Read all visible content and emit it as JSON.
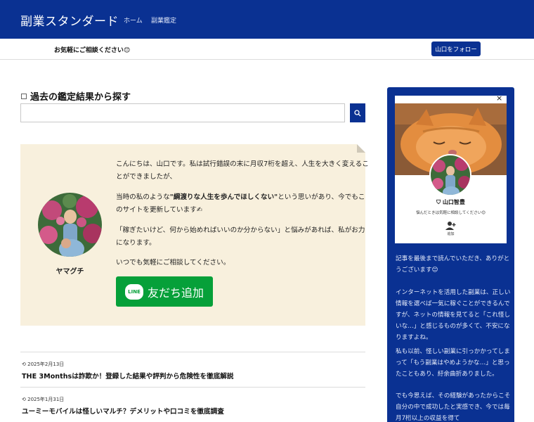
{
  "header": {
    "site_title": "副業スタンダード",
    "nav": [
      "ホーム",
      "副業鑑定"
    ]
  },
  "notice": {
    "text": "お気軽にご相談ください😊",
    "follow_button": "山口をフォロー"
  },
  "search": {
    "heading": "過去の鑑定結果から探す",
    "value": "",
    "placeholder": ""
  },
  "profile": {
    "name": "ヤマグチ",
    "para1": "こんにちは、山口です。私は試行錯誤の末に月収7桁を超え、人生を大きく変えることができましたが、",
    "para2_pre": "当時の私のような",
    "para2_bold": "\"綱渡りな人生を歩んでほしくない\"",
    "para2_post": "という思いがあり、今でもこのサイトを更新しています✍",
    "para3": "「稼ぎたいけど、何から始めればいいのか分からない」と悩みがあれば、私がお力になります。",
    "para4": "いつでも気軽にご相談してください。",
    "line_logo": "LINE",
    "line_button": "友だち追加"
  },
  "posts": [
    {
      "date": "2025年2月13日",
      "title": "THE 3Monthsは詐欺か！登録した結果や評判から危険性を徹底解説"
    },
    {
      "date": "2025年1月31日",
      "title": "ユーミーモバイルは怪しいマルチ？デメリットや口コミを徹底調査"
    }
  ],
  "sidebar": {
    "close": "×",
    "widget_name": "山口智豊",
    "widget_message": "悩んだときは気軽に相談してください😊",
    "widget_follow_label": "追加",
    "text1": "記事を最後まで読んでいただき、ありがとうございます😊",
    "text2": "インターネットを活用した副業は、正しい情報を選べば一気に稼ぐことができるんですが、ネットの情報を見てると「これ怪しいな…」と感じるものが多くて、不安になりますよね。",
    "text3": "私も以前、怪しい副業に引っかかってしまって「もう副業はやめようかな…」と思ったこともあり、紆余曲折ありました。",
    "text4": "でも今思えば、その経験があったからこそ自分の中で成功したと実感でき、今では毎月7桁以上の収益を得て"
  },
  "colors": {
    "brand": "#0a3192",
    "card_bg": "#f8f0dd",
    "line_green": "#06a039"
  }
}
